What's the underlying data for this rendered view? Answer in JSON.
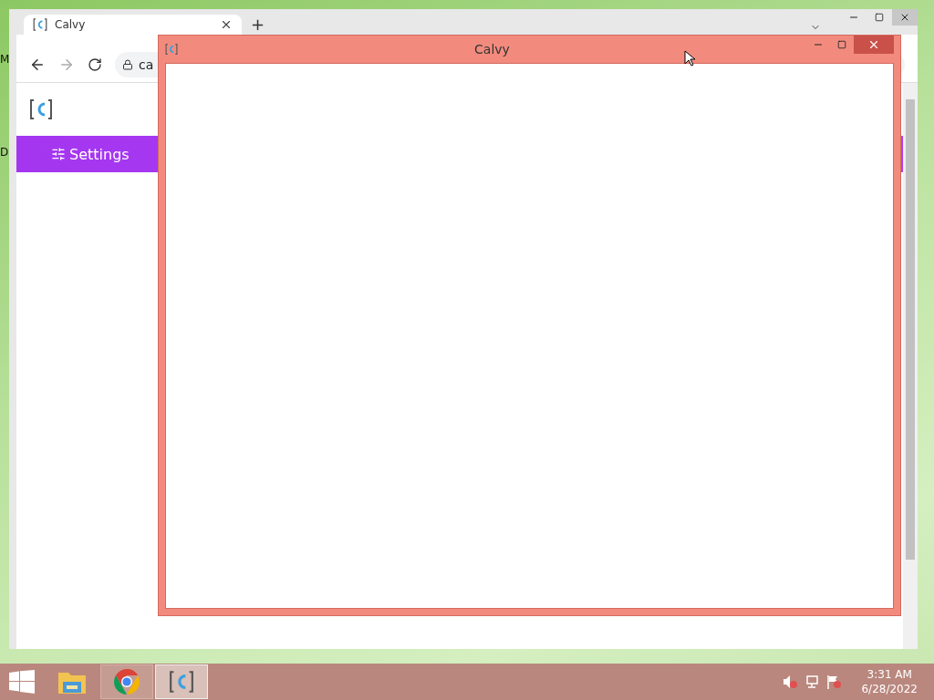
{
  "desktop": {
    "icon_labels": [
      "M",
      "D"
    ]
  },
  "browser": {
    "tab": {
      "title": "Calvy"
    },
    "new_tab": "+",
    "address": "ca",
    "forward_disabled": true,
    "nav": [
      {
        "label": "Settings"
      }
    ]
  },
  "app_window": {
    "title": "Calvy"
  },
  "taskbar": {
    "apps": [
      {
        "kind": "explorer",
        "running": false,
        "selected": false
      },
      {
        "kind": "chrome",
        "running": true,
        "selected": false
      },
      {
        "kind": "calvy",
        "running": true,
        "selected": true
      }
    ],
    "time": "3:31 AM",
    "date": "6/28/2022"
  }
}
